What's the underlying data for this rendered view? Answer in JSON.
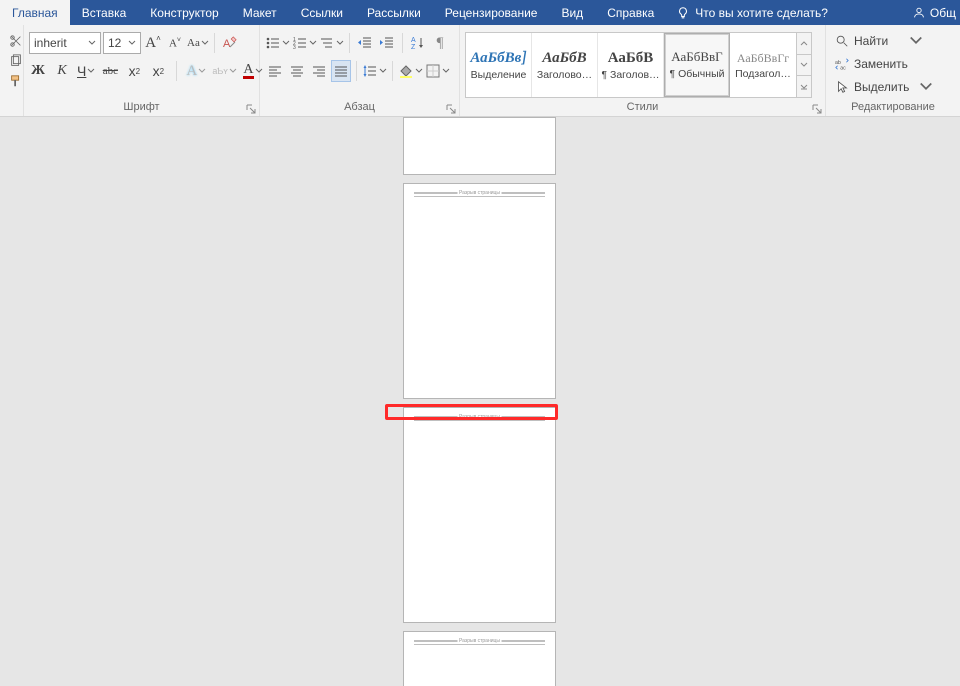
{
  "tabs": {
    "items": [
      "Главная",
      "Вставка",
      "Конструктор",
      "Макет",
      "Ссылки",
      "Рассылки",
      "Рецензирование",
      "Вид",
      "Справка"
    ],
    "active_index": 0,
    "tell_me": "Что вы хотите сделать?",
    "share": "Общ"
  },
  "font": {
    "name": "inherit",
    "size": "12",
    "bold": "Ж",
    "italic": "К",
    "underline": "Ч",
    "strike": "abc",
    "grow": "A",
    "shrink": "A",
    "case": "Aa",
    "sub": "x",
    "sup": "x",
    "color": "A",
    "effects": "A",
    "highlight": "aƄʏ",
    "group_label": "Шрифт"
  },
  "para": {
    "group_label": "Абзац"
  },
  "styles": {
    "group_label": "Стили",
    "items": [
      {
        "preview": "АаБбВв]",
        "caption": "Выделение",
        "preview_style": "color:#2e74b5;font-style:italic;font-weight:bold;"
      },
      {
        "preview": "АаБбВ",
        "caption": "Заголово…",
        "preview_style": "font-weight:bold;font-style:italic;"
      },
      {
        "preview": "АаБбВ",
        "caption": "¶ Заголов…",
        "preview_style": "font-weight:bold;"
      },
      {
        "preview": "АаБбВвГ",
        "caption": "¶ Обычный",
        "preview_style": "font-size:13px;",
        "selected": true
      },
      {
        "preview": "АаБбВвГг",
        "caption": "Подзагол…",
        "preview_style": "color:#888;font-size:12px;"
      }
    ]
  },
  "editing": {
    "group_label": "Редактирование",
    "find": "Найти",
    "replace": "Заменить",
    "select": "Выделить"
  },
  "header_text": "Разрыв страницы"
}
